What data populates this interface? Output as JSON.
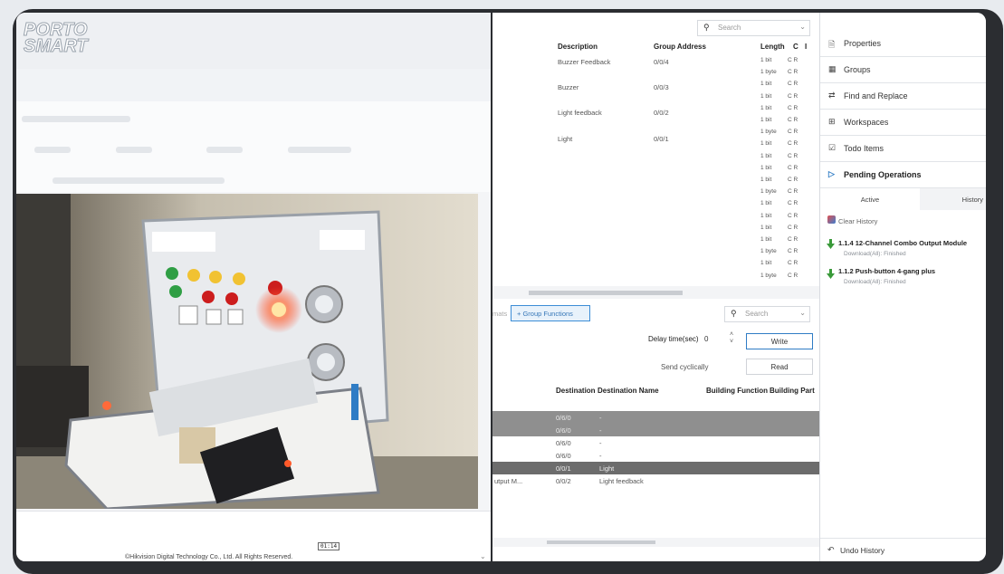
{
  "viewer": {
    "logo_line1": "PORTO",
    "logo_line2": "SMART",
    "copyright": "©Hikvision Digital Technology Co., Ltd. All Rights Reserved.",
    "time_box": "01:14"
  },
  "group_table": {
    "search_placeholder": "Search",
    "columns": [
      "Description",
      "Group Address",
      "Length",
      "C",
      "I"
    ],
    "rows": [
      {
        "description": "Buzzer Feedback",
        "group_address": "0/0/4"
      },
      {
        "description": "Buzzer",
        "group_address": "0/0/3"
      },
      {
        "description": "Light feedback",
        "group_address": "0/0/2"
      },
      {
        "description": "Light",
        "group_address": "0/0/1"
      }
    ],
    "lengths": [
      "1 bit",
      "1 byte",
      "1 bit",
      "1 bit",
      "1 bit",
      "1 bit",
      "1 byte",
      "1 bit",
      "1 bit",
      "1 bit",
      "1 bit",
      "1 byte",
      "1 bit",
      "1 bit",
      "1 bit",
      "1 bit",
      "1 byte",
      "1 bit",
      "1 byte"
    ],
    "cr_label": "C R"
  },
  "bottom_panel": {
    "tab_prev": "mats",
    "tab_group_functions": "Group Functions",
    "search_placeholder": "Search",
    "delay_label": "Delay time(sec)",
    "delay_value": "0",
    "write_label": "Write",
    "send_cyclically": "Send cyclically",
    "read_label": "Read",
    "columns": [
      "Destination",
      "Destination Name",
      "Building Function",
      "Building Part"
    ],
    "rows": [
      {
        "source": "",
        "destination": "0/6/0",
        "name": "-"
      },
      {
        "source": "",
        "destination": "0/6/0",
        "name": "-"
      },
      {
        "source": "",
        "destination": "0/6/0",
        "name": "-"
      },
      {
        "source": "",
        "destination": "0/6/0",
        "name": "-"
      },
      {
        "source": "",
        "destination": "0/0/1",
        "name": "Light"
      },
      {
        "source": "utput M...",
        "destination": "0/0/2",
        "name": "Light feedback"
      }
    ]
  },
  "side_panel": {
    "items": [
      {
        "label": "Properties",
        "icon": "document-icon"
      },
      {
        "label": "Groups",
        "icon": "groups-icon"
      },
      {
        "label": "Find and Replace",
        "icon": "find-replace-icon"
      },
      {
        "label": "Workspaces",
        "icon": "workspaces-icon"
      },
      {
        "label": "Todo Items",
        "icon": "todo-icon"
      },
      {
        "label": "Pending Operations",
        "icon": "play-icon"
      }
    ],
    "tab_active": "Active",
    "tab_history": "History",
    "clear_history": "Clear History",
    "history": [
      {
        "title": "1.1.4 12-Channel Combo Output Module",
        "status": "Download(All): Finished"
      },
      {
        "title": "1.1.2 Push-button 4-gang plus",
        "status": "Download(All): Finished"
      }
    ],
    "undo_history": "Undo History"
  },
  "colors": {
    "accent": "#2f7cc5",
    "frame": "#2b2d31",
    "selected_row": "#6c6c6c",
    "gray_row": "#8f8f8f"
  }
}
